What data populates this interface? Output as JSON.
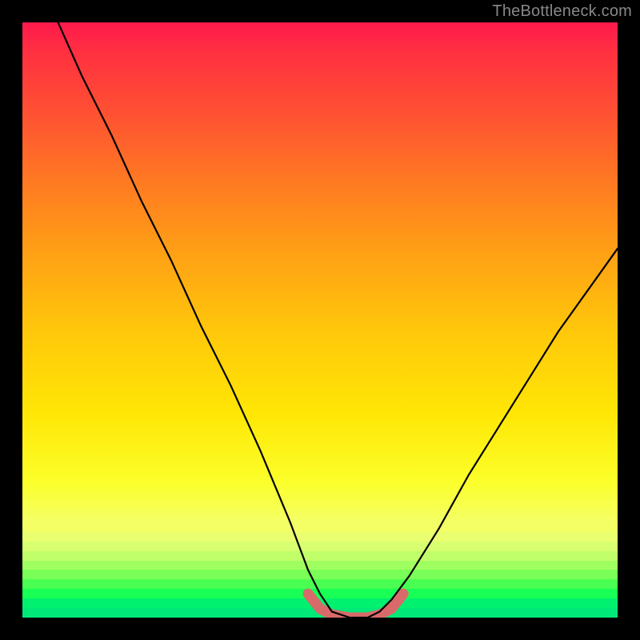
{
  "watermark": "TheBottleneck.com",
  "chart_data": {
    "type": "line",
    "title": "",
    "xlabel": "",
    "ylabel": "",
    "xlim": [
      0,
      100
    ],
    "ylim": [
      0,
      100
    ],
    "series": [
      {
        "name": "bottleneck-curve",
        "x": [
          6,
          10,
          15,
          20,
          25,
          30,
          35,
          40,
          45,
          48,
          50,
          52,
          55,
          58,
          60,
          62,
          65,
          70,
          75,
          80,
          85,
          90,
          95,
          100
        ],
        "y": [
          100,
          91,
          81,
          70,
          60,
          49,
          39,
          28,
          16,
          8,
          4,
          1,
          0,
          0,
          1,
          3,
          7,
          15,
          24,
          32,
          40,
          48,
          55,
          62
        ],
        "color": "#000000"
      },
      {
        "name": "optimal-range-marker",
        "x": [
          48,
          50,
          52,
          55,
          58,
          60,
          62,
          64
        ],
        "y": [
          4,
          1.5,
          0.5,
          0,
          0,
          0.5,
          1.5,
          4
        ],
        "color": "#d96a6a"
      }
    ],
    "background": {
      "type": "vertical-gradient-danger-to-safe",
      "stops": [
        {
          "pos": 0.0,
          "color": "#ff1a4d"
        },
        {
          "pos": 0.5,
          "color": "#ffb010"
        },
        {
          "pos": 0.84,
          "color": "#f6ff5a"
        },
        {
          "pos": 1.0,
          "color": "#00ff66"
        }
      ],
      "bottom_banding_colors": [
        "#f4ff66",
        "#eaff70",
        "#d8ff70",
        "#c0ff6a",
        "#a0ff60",
        "#7aff58",
        "#4aff52",
        "#18ff55",
        "#00f070",
        "#00e878"
      ]
    }
  }
}
